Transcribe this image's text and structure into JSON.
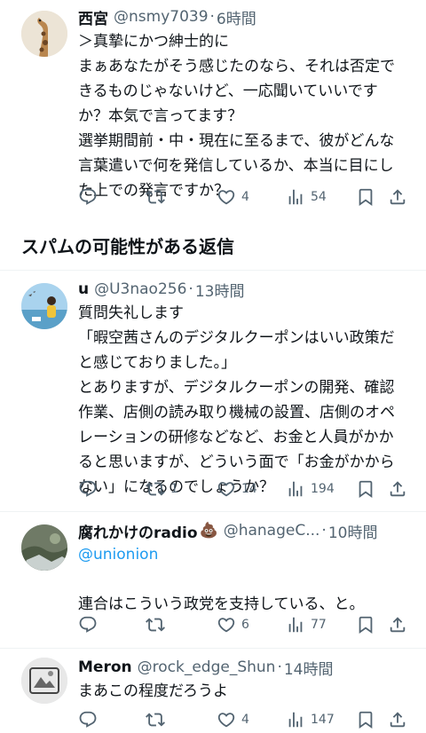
{
  "tweets": [
    {
      "name": "西宮",
      "handle": "@nsmy7039",
      "time": "6時間",
      "lines": [
        "＞真摯にかつ紳士的に",
        "まぁあなたがそう感じたのなら、それは否定で",
        "きるものじゃないけど、一応聞いていいです",
        "か？本気で言ってます？",
        "選挙期間前・中・現在に至るまで、彼がどんな",
        "言葉遣いで何を発信しているか、本当に目にし",
        "た上での発言ですか？"
      ],
      "reply_count": "",
      "retweet_count": "",
      "like_count": "4",
      "view_count": "54"
    },
    {
      "name": "u",
      "handle": "@U3nao256",
      "time": "13時間",
      "lines": [
        "質問失礼します",
        "「暇空茜さんのデジタルクーポンはいい政策だ",
        "と感じておりました。」",
        "とありますが、デジタルクーポンの開発、確認",
        "作業、店側の読み取り機械の設置、店側のオペ",
        "レーションの研修などなど、お金と人員がかか",
        "ると思いますが、どういう面で「お金がかから",
        "ない」になるのでしょうか？"
      ],
      "reply_count": "",
      "retweet_count": "1",
      "like_count": "14",
      "view_count": "194"
    },
    {
      "name": "腐れかけのradio",
      "name_emoji": "💩",
      "handle": "@hanageC...",
      "time": "10時間",
      "mention": "@unionion",
      "lines": [
        "連合はこういう政党を支持している、と。"
      ],
      "reply_count": "",
      "retweet_count": "",
      "like_count": "6",
      "view_count": "77"
    },
    {
      "name": "Meron",
      "handle": "@rock_edge_Shun",
      "time": "14時間",
      "lines": [
        "まあこの程度だろうよ"
      ],
      "reply_count": "",
      "retweet_count": "",
      "like_count": "4",
      "view_count": "147"
    }
  ],
  "section": {
    "title": "スパムの可能性がある返信"
  },
  "time_separator": "·",
  "icons": [
    "reply-icon",
    "retweet-icon",
    "like-icon",
    "views-icon",
    "bookmark-icon",
    "share-icon"
  ],
  "colors": {
    "text": "#0f1419",
    "secondary": "#536471",
    "link": "#1d9bf0",
    "divider": "#eff3f4"
  }
}
